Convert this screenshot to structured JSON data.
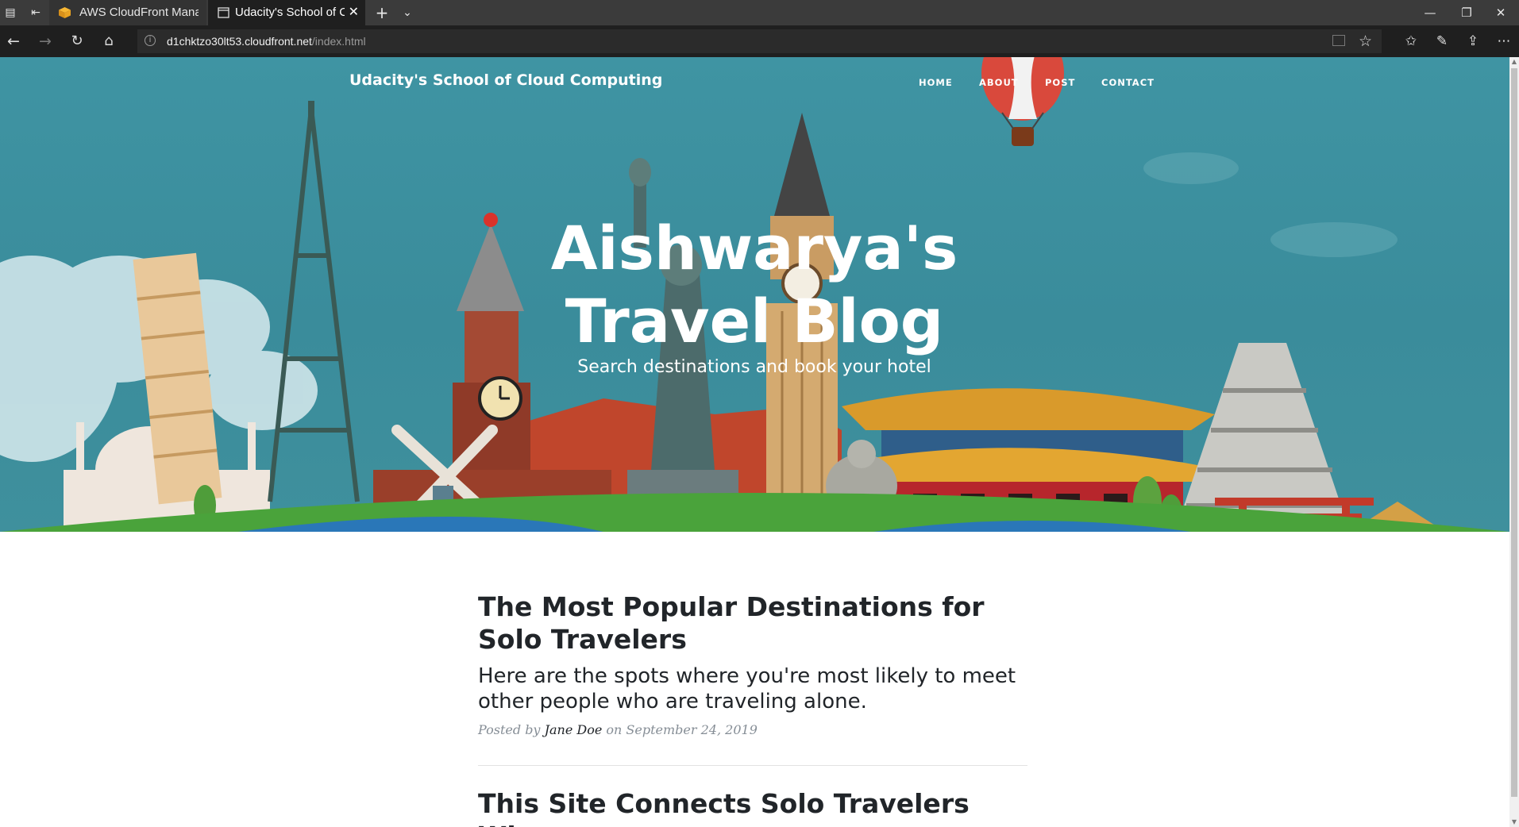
{
  "browser": {
    "tabs": [
      {
        "label": "AWS CloudFront Managem",
        "active": false,
        "icon": "aws-cube-icon"
      },
      {
        "label": "Udacity's School of Clou",
        "active": true,
        "icon": "page-icon"
      }
    ],
    "url_host": "d1chktzo30lt53.cloudfront.net",
    "url_path": "/index.html"
  },
  "site": {
    "brand": "Udacity's School of Cloud Computing",
    "nav": [
      "HOME",
      "ABOUT",
      "POST",
      "CONTACT"
    ]
  },
  "hero": {
    "title_line1": "Aishwarya's",
    "title_line2": "Travel Blog",
    "subtitle": "Search destinations and book your hotel"
  },
  "posts": [
    {
      "title": "The Most Popular Destinations for Solo Travelers",
      "subtitle": "Here are the spots where you're most likely to meet other people who are traveling alone.",
      "meta_prefix": "Posted by",
      "author": "Jane Doe",
      "meta_suffix": "on September 24, 2019"
    },
    {
      "title": "This Site Connects Solo Travelers Who"
    }
  ],
  "colors": {
    "hero_sky": "#3f94a3",
    "text_dark": "#212529",
    "meta_gray": "#868e96",
    "chrome_dark": "#1f1f1f",
    "tabbar": "#3b3b3b"
  }
}
